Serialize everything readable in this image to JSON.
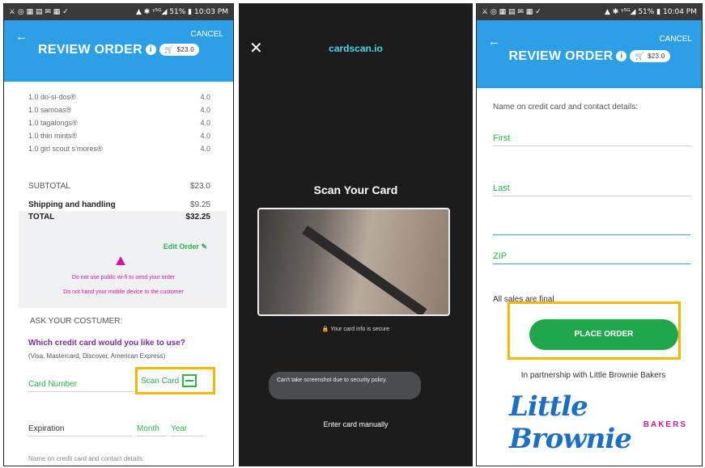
{
  "panel1": {
    "status_left": "⚔ ◎ ▦ ▤ ✉ ▦ ✓",
    "status_right": "▲ ✱ ᵞ⁵ᴳ◢ 51% ▮ 10:03 PM",
    "cancel": "CANCEL",
    "title": "REVIEW ORDER",
    "cart_total": "$23.0",
    "items": [
      {
        "name": "1.0 do-si-dos®",
        "qty": "4.0"
      },
      {
        "name": "1.0 samoas®",
        "qty": "4.0"
      },
      {
        "name": "1.0 tagalongs®",
        "qty": "4.0"
      },
      {
        "name": "1.0 thin mints®",
        "qty": "4.0"
      },
      {
        "name": "1.0 girl scout s’mores®",
        "qty": "4.0"
      }
    ],
    "subtotal_label": "SUBTOTAL",
    "subtotal_value": "$23.0",
    "shipping_label": "Shipping and handling",
    "shipping_value": "$9.25",
    "total_label": "TOTAL",
    "total_value": "$32.25",
    "edit_order": "Edit Order",
    "warning1": "Do not use public wi-fi to send your order",
    "warning2": "Do not hand your mobile device to the customer",
    "ask": "ASK YOUR COSTUMER:",
    "which_card": "Which credit card would you like to use?",
    "card_types": "(Visa, Mastercard, Discover, American Express)",
    "card_number": "Card Number",
    "scan_card": "Scan Card",
    "expiration": "Expiration",
    "month": "Month",
    "year": "Year",
    "name_on_card_partial": "Name on credit card and contact details:"
  },
  "panel2": {
    "brand": "cardscan.io",
    "title": "Scan Your Card",
    "secure": "Your card info is secure",
    "toast": "Can't take screenshot due to security policy.",
    "enter_manually": "Enter card manually"
  },
  "panel3": {
    "status_left": "⚔ ◎ ▦ ▤ ✉ ▦ ✓",
    "status_right": "▲ ✱ ᵞ⁵ᴳ◢ 51% ▮ 10:04 PM",
    "cancel": "CANCEL",
    "title": "REVIEW ORDER",
    "cart_total": "$23.0",
    "name_label": "Name on credit card and contact details:",
    "first": "First",
    "last": "Last",
    "zip": "ZIP",
    "all_sales_final": "All sales are final",
    "place_order": "PLACE ORDER",
    "partnership": "In partnership with Little Brownie Bakers",
    "logo_text": "Little Brownie",
    "logo_sub": "BAKERS"
  },
  "colors": {
    "appbar": "#2d9fe6",
    "green": "#2db34a",
    "magenta": "#d5169c",
    "highlight": "#f5b700"
  }
}
